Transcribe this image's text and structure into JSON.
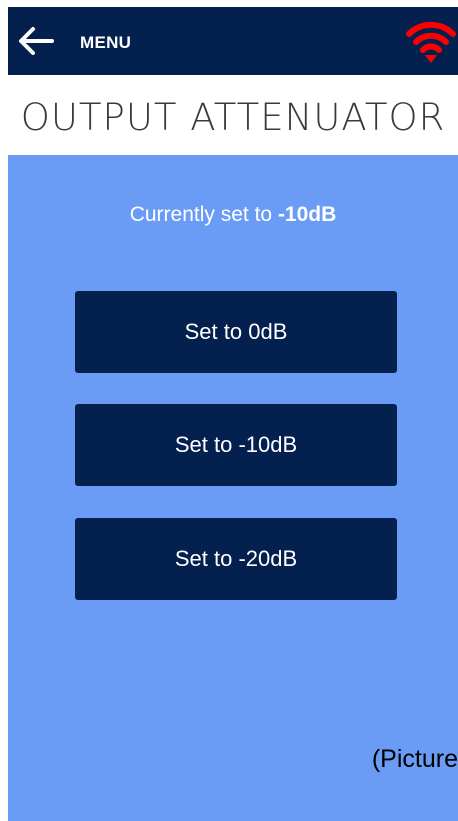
{
  "header": {
    "menu_label": "MENU",
    "back_icon": "arrow-left-icon",
    "wifi_icon": "wifi-icon",
    "wifi_color": "#ff0000",
    "bar_color": "#03204f"
  },
  "page": {
    "title": "OUTPUT ATTENUATOR"
  },
  "status": {
    "prefix": "Currently set to ",
    "value": "-10dB"
  },
  "buttons": [
    {
      "label": "Set to 0dB"
    },
    {
      "label": "Set to -10dB"
    },
    {
      "label": "Set to -20dB"
    }
  ],
  "caption": "(Picture",
  "colors": {
    "panel": "#6b9cf5",
    "button": "#03204f",
    "text_on_dark": "#ffffff"
  }
}
